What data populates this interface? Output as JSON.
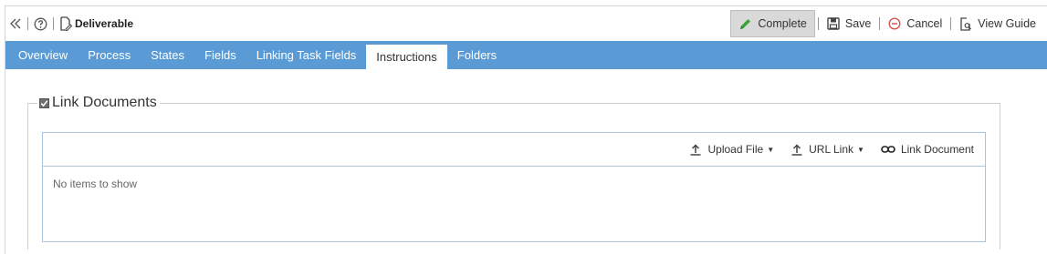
{
  "toolbar": {
    "title": "Deliverable",
    "icons": {
      "collapse": "double-chevron-left-icon",
      "help": "help-circle-icon",
      "doc": "document-edit-icon"
    },
    "actions": {
      "complete": "Complete",
      "save": "Save",
      "cancel": "Cancel",
      "view_guide": "View Guide"
    }
  },
  "tabs": [
    {
      "label": "Overview"
    },
    {
      "label": "Process"
    },
    {
      "label": "States"
    },
    {
      "label": "Fields"
    },
    {
      "label": "Linking Task Fields"
    },
    {
      "label": "Instructions",
      "active": true
    },
    {
      "label": "Folders"
    }
  ],
  "link_documents": {
    "checked": true,
    "legend": "Link Documents",
    "buttons": {
      "upload_file": "Upload File",
      "url_link": "URL Link",
      "link_document": "Link Document"
    },
    "empty_text": "No items to show"
  },
  "colors": {
    "tab_bar": "#5a9bd5",
    "complete_icon": "#3aa63a",
    "cancel_icon": "#d9534f"
  }
}
